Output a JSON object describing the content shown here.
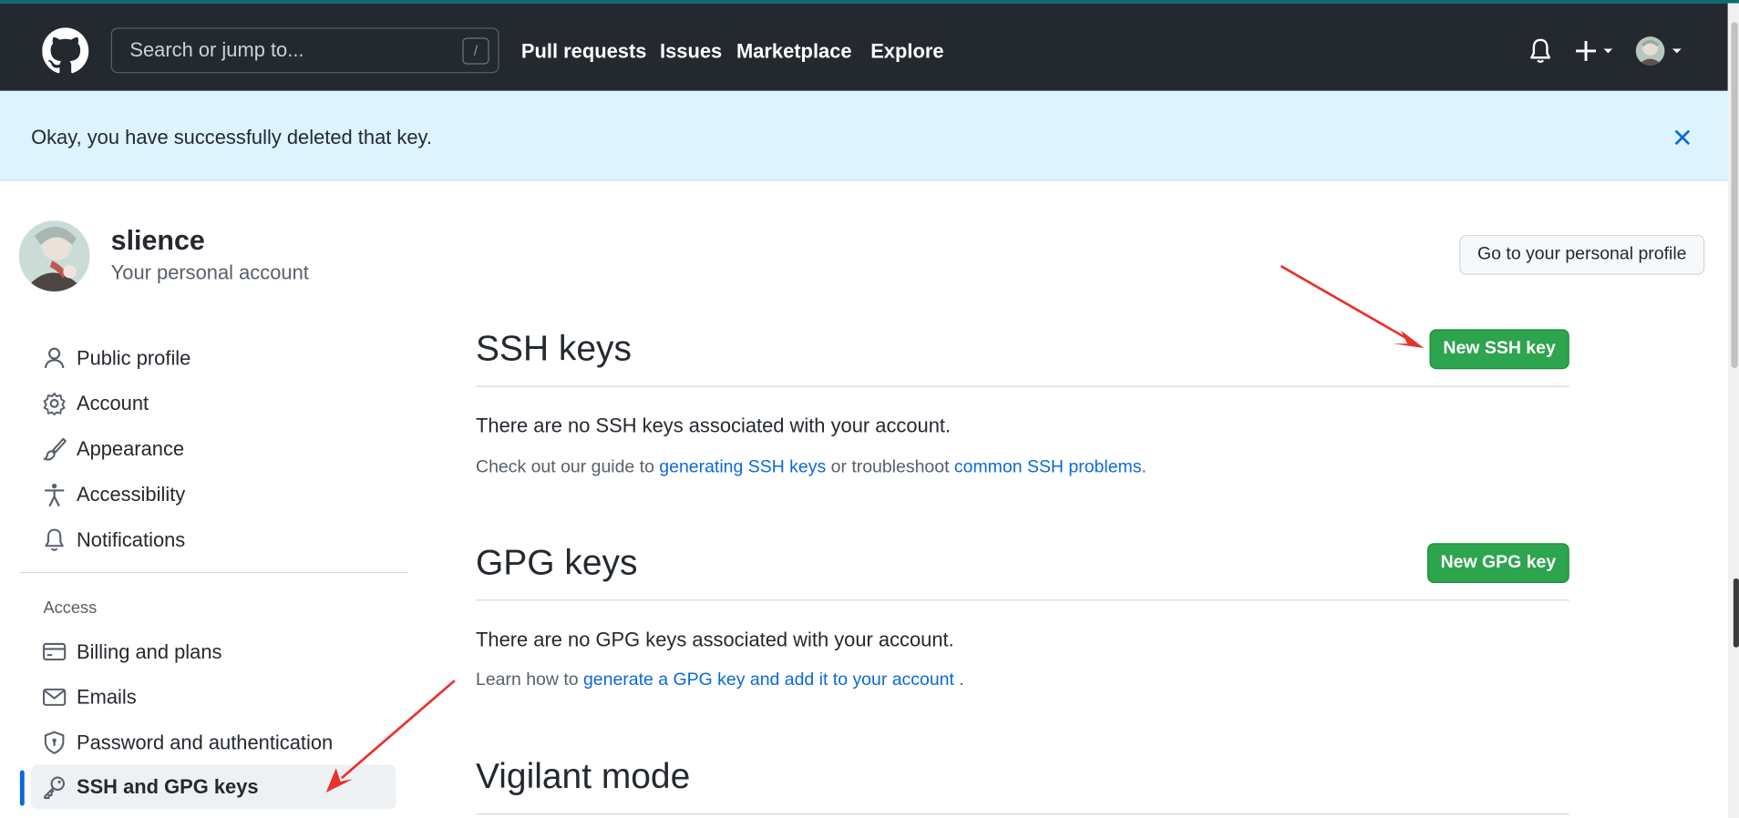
{
  "header": {
    "search_placeholder": "Search or jump to...",
    "search_shortcut": "/",
    "nav": [
      "Pull requests",
      "Issues",
      "Marketplace",
      "Explore"
    ]
  },
  "flash": {
    "message": "Okay, you have successfully deleted that key."
  },
  "account": {
    "username": "slience",
    "subtitle": "Your personal account",
    "profile_button": "Go to your personal profile"
  },
  "sidebar": {
    "items": [
      "Public profile",
      "Account",
      "Appearance",
      "Accessibility",
      "Notifications"
    ],
    "access_heading": "Access",
    "access_items": [
      "Billing and plans",
      "Emails",
      "Password and authentication",
      "SSH and GPG keys"
    ]
  },
  "ssh": {
    "title": "SSH keys",
    "button": "New SSH key",
    "empty": "There are no SSH keys associated with your account.",
    "note_prefix": "Check out our guide to ",
    "link1": "generating SSH keys",
    "note_middle": " or troubleshoot ",
    "link2": "common SSH problems",
    "note_suffix": "."
  },
  "gpg": {
    "title": "GPG keys",
    "button": "New GPG key",
    "empty": "There are no GPG keys associated with your account.",
    "note_prefix": "Learn how to ",
    "link": "generate a GPG key and add it to your account",
    "note_suffix": " ."
  },
  "vigilant": {
    "title": "Vigilant mode"
  },
  "colors": {
    "header_bg": "#24292f",
    "flash_bg": "#ddf4ff",
    "primary_green": "#2da44e",
    "link_blue": "#0969da",
    "annotation_red": "#e8322b"
  }
}
